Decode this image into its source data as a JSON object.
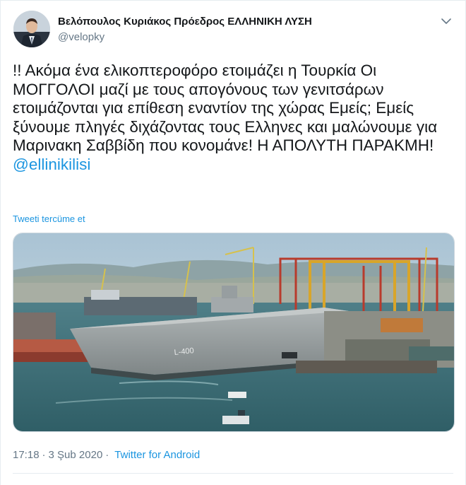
{
  "author": {
    "display_name": "Βελόπουλος Κυριάκος Πρόεδρος ΕΛΛΗΝΙΚΗ ΛΥΣΗ",
    "handle": "@velopky"
  },
  "tweet": {
    "text": "!! Ακόμα ένα ελικοπτεροφόρο ετοιμάζει η Τουρκία Οι ΜΟΓΓΟΛΟΙ μαζί με τους απογόνους των γενιτσάρων ετοιμάζονται για επίθεση εναντίον της χώρας Εμείς; Εμείς ξύνουμε πληγές διχάζοντας τους Ελληνες και μαλώνουμε για Μαρινακη Σαββίδη που κονομάνε! Η ΑΠΟΛΥΤΗ ΠΑΡΑΚΜΗ! ",
    "mention": "@ellinikilisi",
    "translate_label": "Tweeti tercüme et"
  },
  "media": {
    "hull_number": "L-400"
  },
  "meta": {
    "time": "17:18",
    "separator": "·",
    "date": "3 Şub 2020",
    "source": "Twitter for Android"
  },
  "colors": {
    "link": "#1b95e0",
    "secondary_text": "#657786",
    "divider": "#e6ecf0"
  },
  "icons": {
    "caret": "chevron-down-icon",
    "avatar": "avatar"
  }
}
